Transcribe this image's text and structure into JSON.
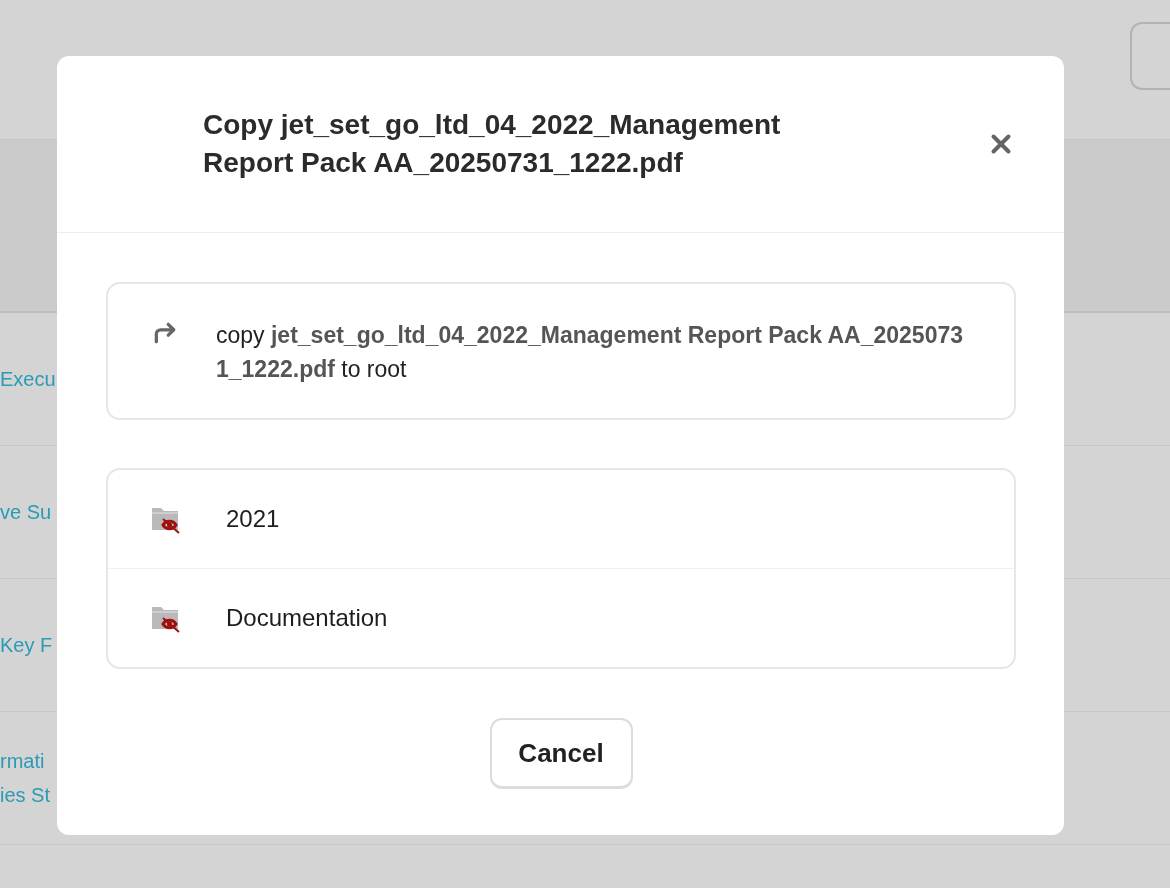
{
  "background": {
    "rows": [
      {
        "link_lines": [
          "Execu"
        ]
      },
      {
        "link_lines": [
          "ve Su"
        ]
      },
      {
        "link_lines": [
          "Key F"
        ]
      },
      {
        "link_lines": [
          "rmati",
          "ies St"
        ]
      }
    ]
  },
  "dialog": {
    "title": "Copy jet_set_go_ltd_04_2022_Management Report Pack AA_20250731_1222.pdf",
    "summary": "copy **jet_set_go_ltd_04_2022_Management Report Pack AA_20250731_1222.pdf** to root",
    "folders": [
      {
        "name": "2021",
        "hidden": true
      },
      {
        "name": "Documentation",
        "hidden": true
      }
    ],
    "buttons": [
      {
        "label": "Cancel"
      }
    ]
  }
}
